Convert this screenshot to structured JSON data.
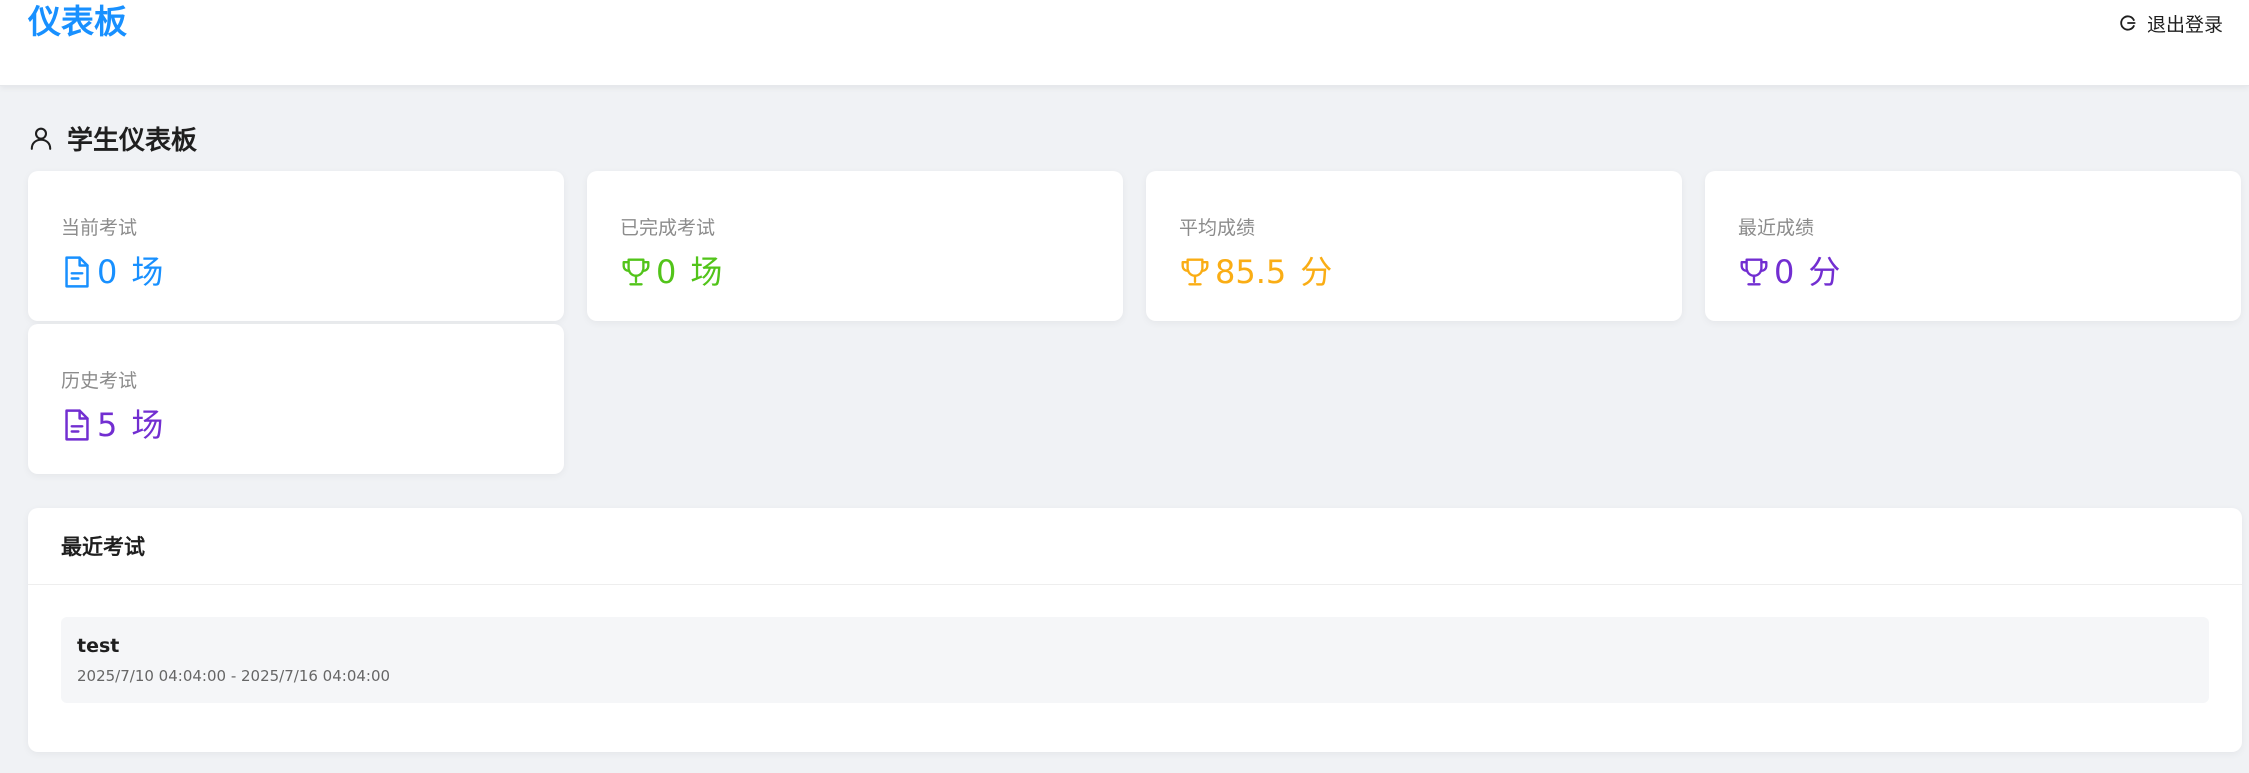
{
  "header": {
    "title": "仪表板",
    "title_color": "#1890ff",
    "logout_label": "退出登录",
    "logout_icon": "logout-icon"
  },
  "section": {
    "title": "学生仪表板",
    "icon": "user-icon"
  },
  "stats": {
    "current": {
      "label": "当前考试",
      "value": "0",
      "unit": "场",
      "icon": "file-text-icon",
      "color": "#1890ff"
    },
    "completed": {
      "label": "已完成考试",
      "value": "0",
      "unit": "场",
      "icon": "trophy-icon",
      "color": "#52c41a"
    },
    "average": {
      "label": "平均成绩",
      "value": "85.5",
      "unit": "分",
      "icon": "trophy-icon",
      "color": "#faad14"
    },
    "latest": {
      "label": "最近成绩",
      "value": "0",
      "unit": "分",
      "icon": "trophy-icon",
      "color": "#722ed1"
    },
    "history": {
      "label": "历史考试",
      "value": "5",
      "unit": "场",
      "icon": "file-text-icon",
      "color": "#722ed1"
    }
  },
  "recent": {
    "title": "最近考试",
    "exams": [
      {
        "name": "test",
        "time": "2025/7/10 04:04:00 - 2025/7/16 04:04:00"
      }
    ]
  }
}
